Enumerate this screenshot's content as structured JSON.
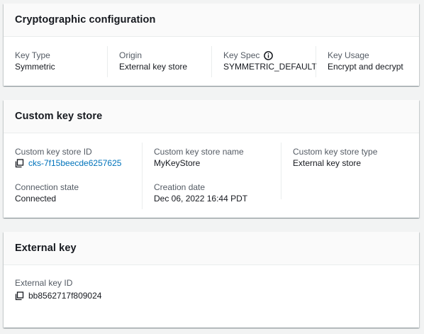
{
  "crypto": {
    "title": "Cryptographic configuration",
    "fields": [
      {
        "label": "Key Type",
        "value": "Symmetric"
      },
      {
        "label": "Origin",
        "value": "External key store"
      },
      {
        "label": "Key Spec",
        "value": "SYMMETRIC_DEFAULT",
        "icon": "info-icon"
      },
      {
        "label": "Key Usage",
        "value": "Encrypt and decrypt"
      }
    ]
  },
  "custom_key_store": {
    "title": "Custom key store",
    "store_id_label": "Custom key store ID",
    "store_id_value": "cks-7f15beecde6257625",
    "store_name_label": "Custom key store name",
    "store_name_value": "MyKeyStore",
    "store_type_label": "Custom key store type",
    "store_type_value": "External key store",
    "connection_label": "Connection state",
    "connection_value": "Connected",
    "creation_label": "Creation date",
    "creation_value": "Dec 06, 2022 16:44 PDT"
  },
  "external_key": {
    "title": "External key",
    "id_label": "External key ID",
    "id_value": "bb8562717f809024"
  },
  "icons": {
    "copy": "copy-icon",
    "info": "info-icon"
  },
  "colors": {
    "link": "#0073bb",
    "label": "#545b64",
    "text": "#16191f",
    "background": "#f2f3f3"
  }
}
